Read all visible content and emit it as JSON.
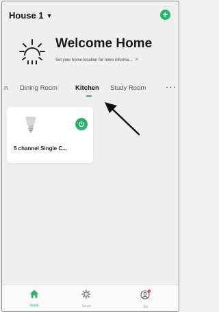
{
  "header": {
    "home_name": "House 1"
  },
  "welcome": {
    "title": "Welcome Home",
    "subtitle": "Set your home location for more informa..."
  },
  "tabs": [
    {
      "label": "n"
    },
    {
      "label": "Dining Room"
    },
    {
      "label": "Kitchen"
    },
    {
      "label": "Study Room"
    }
  ],
  "active_tab": "Kitchen",
  "devices": [
    {
      "name": "5 channel Single C..."
    }
  ],
  "bottom_nav": [
    {
      "label": "Home"
    },
    {
      "label": "Smart"
    },
    {
      "label": "Me"
    }
  ],
  "colors": {
    "accent": "#27b36e",
    "background": "#efefef",
    "card": "#ffffff",
    "badge": "#e5484d"
  },
  "icons": [
    "chevron-down-icon",
    "add-icon",
    "sun-icon",
    "chevron-right-icon",
    "more-icon",
    "bulb-icon",
    "power-icon",
    "home-icon",
    "smart-icon",
    "profile-icon",
    "pointer-arrow-icon"
  ]
}
